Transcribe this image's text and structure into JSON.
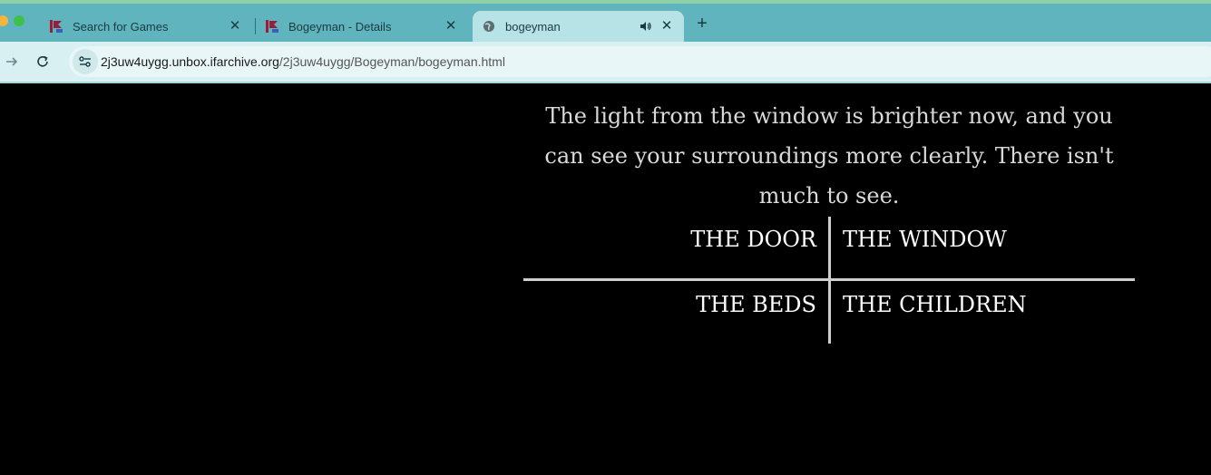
{
  "browser": {
    "tabs": [
      {
        "title": "Search for Games",
        "favicon": "ifdb-icon"
      },
      {
        "title": "Bogeyman - Details",
        "favicon": "ifdb-icon"
      },
      {
        "title": "bogeyman",
        "favicon": "globe-icon",
        "active": true,
        "audio": "speaker-icon"
      }
    ],
    "new_tab_icon": "plus-icon",
    "address": {
      "host": "2j3uw4uygg.unbox.ifarchive.org",
      "path": "/2j3uw4uygg/Bogeyman/bogeyman.html"
    },
    "accent": "#5fb4bd"
  },
  "page": {
    "story_text": "The light from the window is brighter now, and you can see your surroundings more clearly. There isn't much to see.",
    "choices": {
      "top_left": "THE DOOR",
      "top_right": "THE WINDOW",
      "bottom_left": "THE BEDS",
      "bottom_right": "THE CHILDREN"
    },
    "text_color": "#d9d9d9",
    "background": "#000000"
  }
}
